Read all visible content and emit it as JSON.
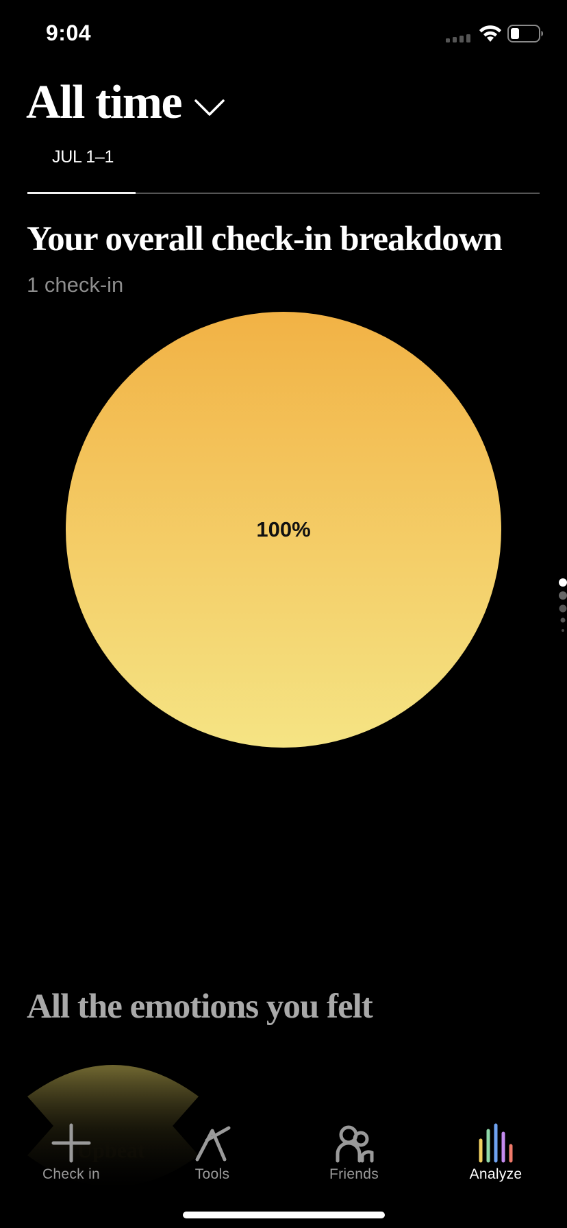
{
  "status_bar": {
    "time": "9:04",
    "icons": [
      "signal-icon",
      "wifi-icon",
      "battery-icon"
    ]
  },
  "header": {
    "title": "All time",
    "dropdown_icon": "chevron-down-icon"
  },
  "date_tabs": {
    "items": [
      {
        "label": "JUL 1–1",
        "selected": true
      }
    ]
  },
  "breakdown": {
    "title": "Your overall check-in breakdown",
    "count_text": "1 check-in"
  },
  "chart_data": {
    "type": "pie",
    "categories": [
      "Upbeat"
    ],
    "values": [
      100
    ],
    "labels": [
      "100%"
    ],
    "colors": [
      {
        "top": "#f2b245",
        "bottom": "#f5e484"
      }
    ]
  },
  "page_indicator": {
    "count": 5,
    "current": 1
  },
  "emotions": {
    "title": "All the emotions you felt",
    "items": [
      {
        "label": "Upbeat",
        "color": "#b8a840"
      }
    ]
  },
  "tab_bar": {
    "items": [
      {
        "label": "Check in",
        "icon": "plus-icon",
        "active": false
      },
      {
        "label": "Tools",
        "icon": "tools-icon",
        "active": false
      },
      {
        "label": "Friends",
        "icon": "friends-icon",
        "active": false
      },
      {
        "label": "Analyze",
        "icon": "analyze-bars-icon",
        "active": true
      }
    ]
  },
  "colors": {
    "background": "#000000",
    "active_tab": "#ffffff",
    "inactive_tab": "#9a9a9a",
    "analyze_bars": [
      "#f0d060",
      "#8fd9a8",
      "#6fa3f2",
      "#c58bf0",
      "#f07a6a"
    ]
  }
}
